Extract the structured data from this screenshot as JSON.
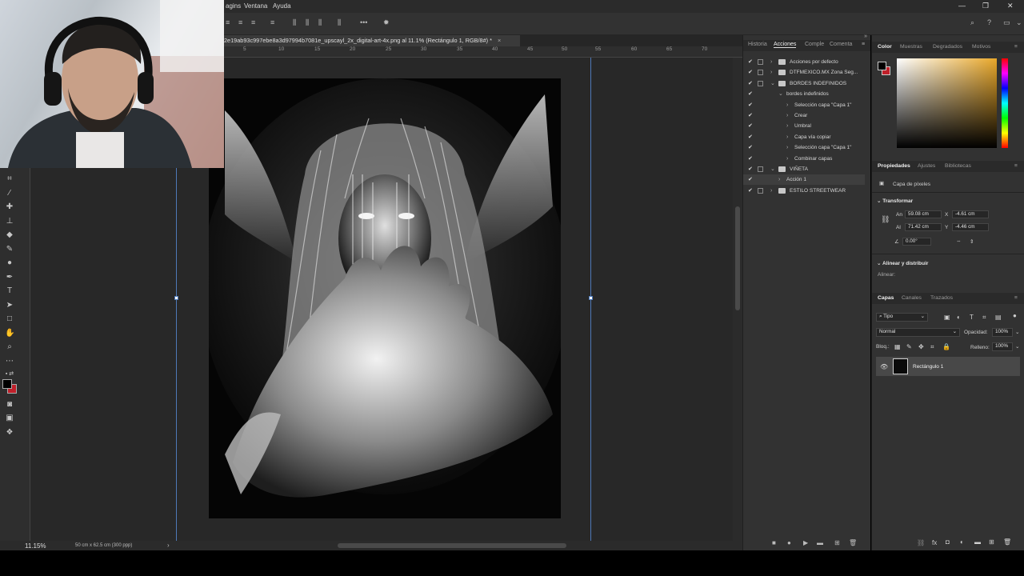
{
  "menubar": {
    "items": [
      "agins",
      "Ventana",
      "Ayuda"
    ],
    "window_controls": [
      "—",
      "❐",
      "✕"
    ]
  },
  "optionsbar": {
    "right_icons": [
      "search-icon",
      "help-icon",
      "workspace-icon"
    ]
  },
  "document": {
    "tab_title": "2e19ab93c997ebe8a3d97994b7081e_upscayl_2x_digital-art-4x.png al 11.1% (Rectángulo 1, RGB/8#) *",
    "close_glyph": "×"
  },
  "ruler": {
    "ticks": [
      "5",
      "10",
      "15",
      "20",
      "25",
      "30",
      "35",
      "40",
      "45",
      "50",
      "55",
      "60",
      "65",
      "70"
    ]
  },
  "status": {
    "zoom": "11.15%",
    "doc_size": "50 cm x 62.5 cm (300 ppp)",
    "arrow": "›"
  },
  "actions_panel": {
    "tabs": [
      "Historia",
      "Acciones",
      "Comple",
      "Comenta"
    ],
    "active_tab": "Acciones",
    "rows": [
      {
        "label": "Acciones por defecto",
        "indent": 0,
        "folder": true,
        "expanded": false
      },
      {
        "label": "DTFMEXICO.MX Zona Seg...",
        "indent": 0,
        "folder": true,
        "expanded": false
      },
      {
        "label": "BORDES INDEFINIDOS",
        "indent": 0,
        "folder": true,
        "expanded": true
      },
      {
        "label": "bordes indefinidos",
        "indent": 1,
        "folder": false,
        "expanded": true
      },
      {
        "label": "Selección capa \"Capa 1\"",
        "indent": 2,
        "folder": false,
        "expanded": false
      },
      {
        "label": "Crear",
        "indent": 2,
        "folder": false,
        "expanded": false
      },
      {
        "label": "Umbral",
        "indent": 2,
        "folder": false,
        "expanded": false
      },
      {
        "label": "Capa vía copiar",
        "indent": 2,
        "folder": false,
        "expanded": false
      },
      {
        "label": "Selección capa \"Capa 1\"",
        "indent": 2,
        "folder": false,
        "expanded": false
      },
      {
        "label": "Combinar capas",
        "indent": 2,
        "folder": false,
        "expanded": false
      },
      {
        "label": "VIÑETA",
        "indent": 0,
        "folder": true,
        "expanded": true
      },
      {
        "label": "Acción 1",
        "indent": 1,
        "folder": false,
        "expanded": false,
        "selected": true
      },
      {
        "label": "ESTILO STREETWEAR",
        "indent": 0,
        "folder": true,
        "expanded": false
      }
    ],
    "check_glyph": "✔"
  },
  "color_panel": {
    "tabs": [
      "Color",
      "Muestras",
      "Degradados",
      "Motivos"
    ],
    "active_tab": "Color",
    "foreground": "#000000",
    "background": "#c0202a"
  },
  "properties_panel": {
    "tabs": [
      "Propiedades",
      "Ajustes",
      "Bibliotecas"
    ],
    "active_tab": "Propiedades",
    "layer_type": "Capa de píxeles",
    "transform_title": "Transformar",
    "width_label": "An",
    "width_value": "59.08 cm",
    "height_label": "Al",
    "height_value": "71.42 cm",
    "x_label": "X",
    "x_value": "-4.61 cm",
    "y_label": "Y",
    "y_value": "-4.46 cm",
    "angle_value": "0.00°",
    "align_title": "Alinear y distribuir",
    "align_label": "Alinear:"
  },
  "layers_panel": {
    "tabs": [
      "Capas",
      "Canales",
      "Trazados"
    ],
    "active_tab": "Capas",
    "filter": "Tipo",
    "blend_mode": "Normal",
    "opacity_label": "Opacidad:",
    "opacity_value": "100%",
    "lock_label": "Bloq.:",
    "fill_label": "Relleno:",
    "fill_value": "100%",
    "layer_name": "Rectángulo 1"
  }
}
